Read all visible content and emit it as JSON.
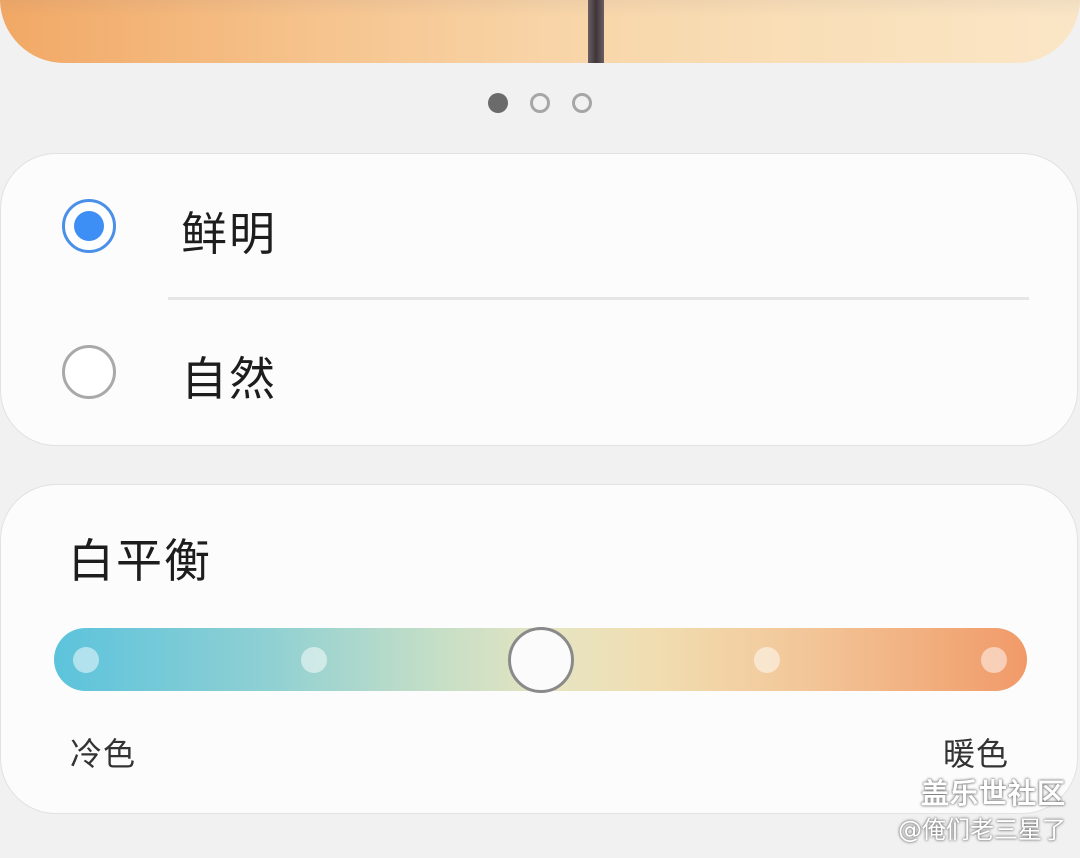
{
  "page_indicator": {
    "count": 3,
    "active_index": 0
  },
  "screen_mode": {
    "options": [
      {
        "label": "鲜明",
        "selected": true
      },
      {
        "label": "自然",
        "selected": false
      }
    ]
  },
  "white_balance": {
    "title": "白平衡",
    "cool_label": "冷色",
    "warm_label": "暖色",
    "level": 0.5,
    "steps": 5
  },
  "watermark": {
    "line1": "盖乐世社区",
    "line2": "@俺们老三星了"
  },
  "colors": {
    "accent": "#3d8ef5",
    "slider_cool": "#5cc3dc",
    "slider_warm": "#f19a68"
  }
}
